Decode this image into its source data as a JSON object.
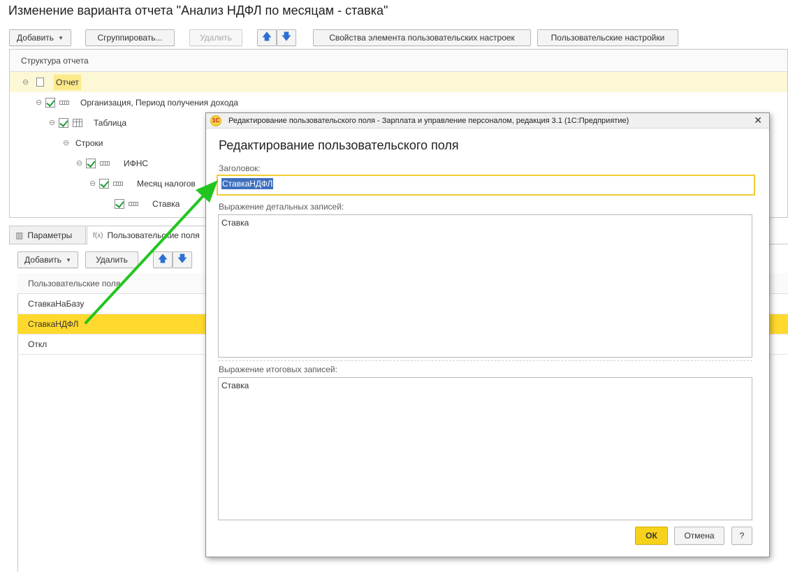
{
  "page": {
    "title": "Изменение варианта отчета \"Анализ НДФЛ по месяцам - ставка\""
  },
  "toolbar": {
    "add": "Добавить",
    "group": "Сгруппировать...",
    "delete": "Удалить",
    "move_up_icon": "arrow-up-icon",
    "move_down_icon": "arrow-down-icon",
    "element_settings": "Свойства элемента пользовательских настроек",
    "user_settings": "Пользовательские настройки"
  },
  "structure": {
    "header": "Структура отчета",
    "items": [
      {
        "label": "Отчет"
      },
      {
        "label": "Организация, Период получения дохода"
      },
      {
        "label": "Таблица"
      },
      {
        "label": "Строки"
      },
      {
        "label": "ИФНС"
      },
      {
        "label": "Месяц налогов"
      },
      {
        "label": "Ставка"
      }
    ]
  },
  "tabs": [
    {
      "label": "Параметры"
    },
    {
      "label": "Пользовательские поля"
    }
  ],
  "fields_toolbar": {
    "add": "Добавить",
    "delete": "Удалить"
  },
  "fields_list": {
    "header": "Пользовательские поля",
    "items": [
      {
        "label": "СтавкаНаБазу"
      },
      {
        "label": "СтавкаНДФЛ"
      },
      {
        "label": "Откл"
      }
    ],
    "selected_color": "#ffd92e"
  },
  "dialog": {
    "window_title": "Редактирование пользовательского поля - Зарплата и управление персоналом, редакция 3.1  (1С:Предприятие)",
    "logo_text": "1С",
    "heading": "Редактирование пользовательского поля",
    "title_label": "Заголовок:",
    "title_value": "СтавкаНДФЛ",
    "detail_label": "Выражение детальных записей:",
    "detail_value": "Ставка",
    "total_label": "Выражение итоговых записей:",
    "total_value": "Ставка",
    "ok": "ОК",
    "cancel": "Отмена",
    "help": "?",
    "ok_color": "#f7d21b"
  },
  "annotation": {
    "arrow_color": "#22c51f"
  }
}
